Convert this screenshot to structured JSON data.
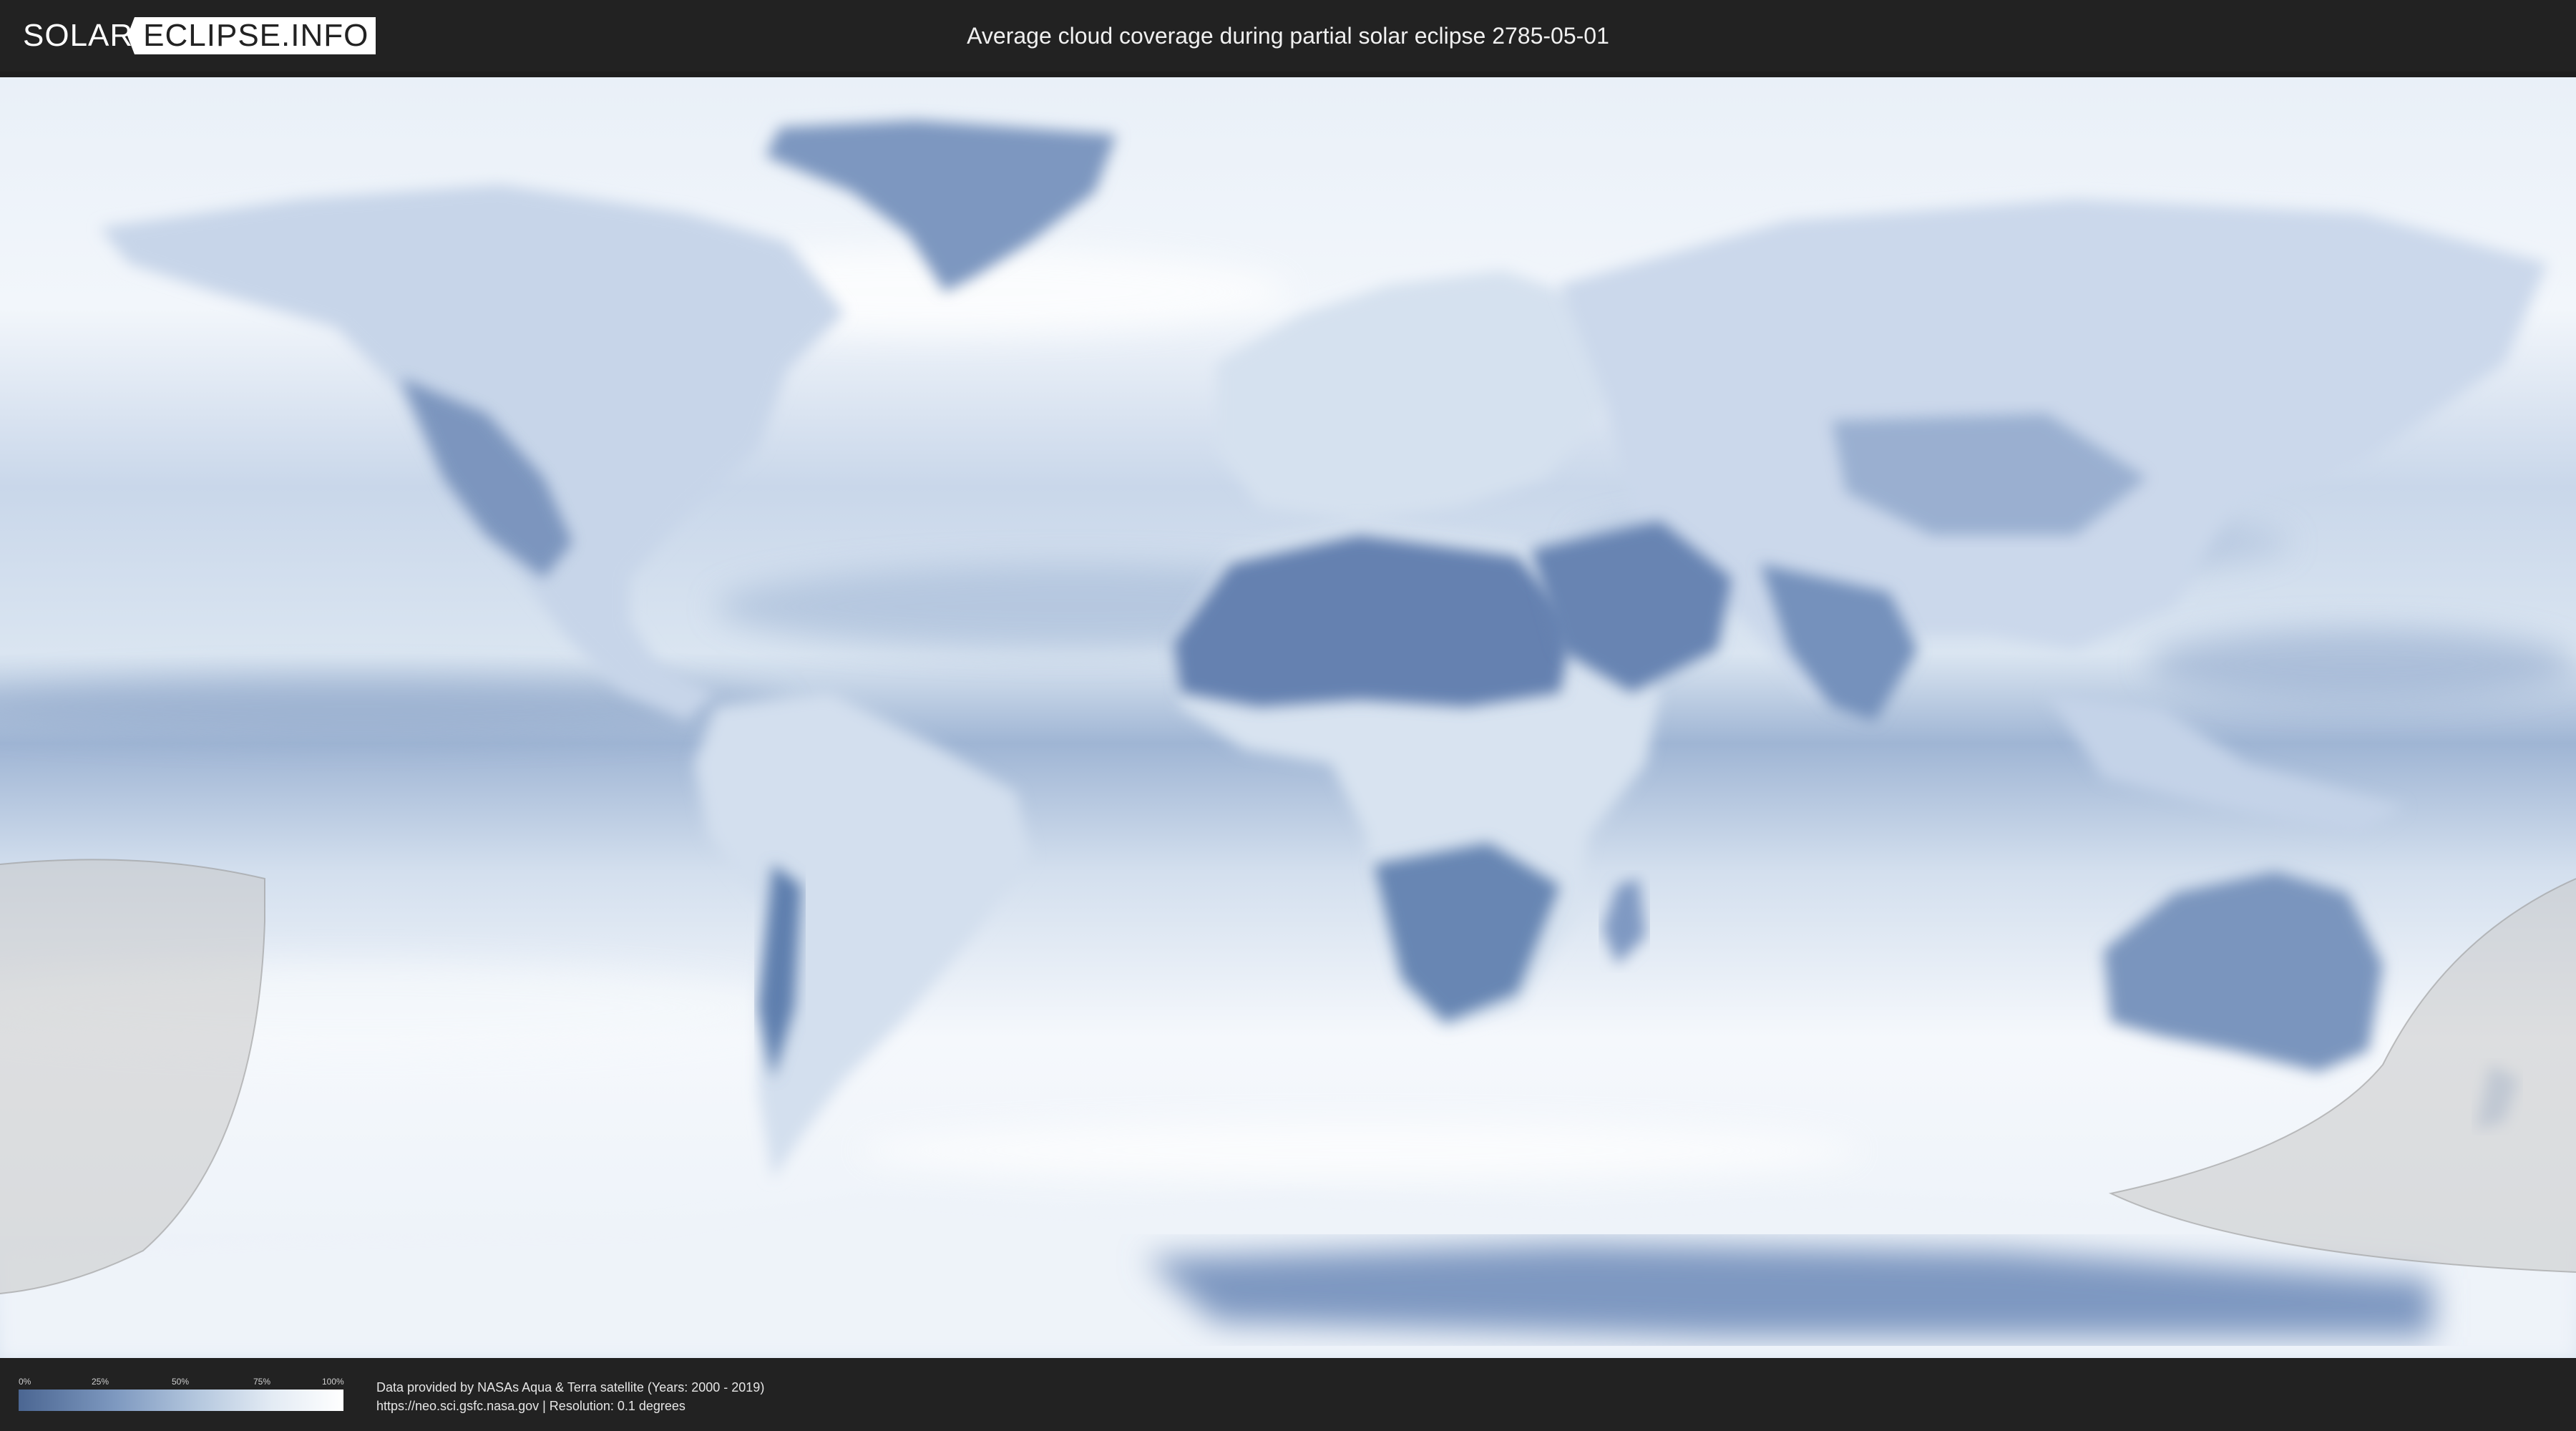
{
  "header": {
    "logo_left": "SOLAR",
    "logo_right": "ECLIPSE.INFO",
    "title": "Average cloud coverage during partial solar eclipse 2785-05-01"
  },
  "map": {
    "type": "cloud-coverage world map",
    "projection": "equirectangular",
    "colors": {
      "clear": "#4b6692",
      "cloudy": "#ffffff",
      "eclipse_shadow": "#c8c8c8"
    }
  },
  "legend": {
    "ticks": [
      "0%",
      "25%",
      "50%",
      "75%",
      "100%"
    ],
    "tick_values": [
      0,
      25,
      50,
      75,
      100
    ]
  },
  "footer": {
    "line1": "Data provided by NASAs Aqua & Terra satellite (Years: 2000 - 2019)",
    "line2": "https://neo.sci.gsfc.nasa.gov | Resolution: 0.1 degrees"
  }
}
